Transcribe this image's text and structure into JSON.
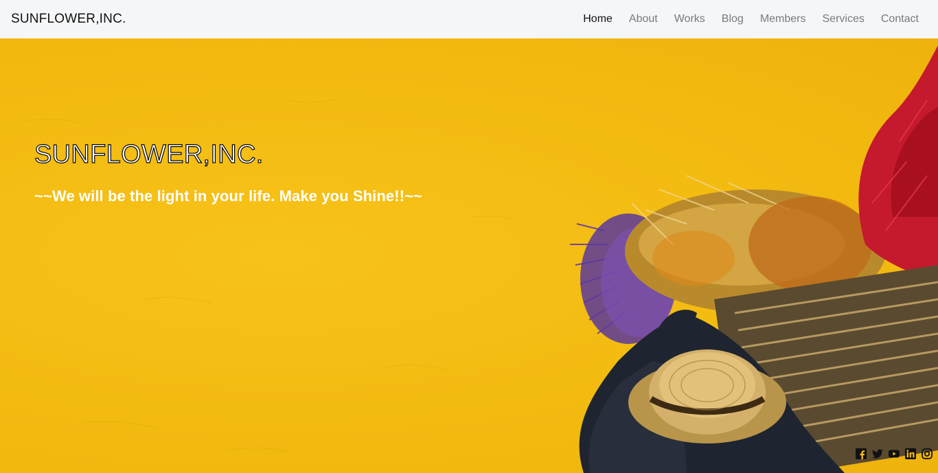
{
  "navbar": {
    "brand": "SUNFLOWER,INC.",
    "links": [
      {
        "label": "Home",
        "active": true
      },
      {
        "label": "About",
        "active": false
      },
      {
        "label": "Works",
        "active": false
      },
      {
        "label": "Blog",
        "active": false
      },
      {
        "label": "Members",
        "active": false
      },
      {
        "label": "Services",
        "active": false
      },
      {
        "label": "Contact",
        "active": false
      }
    ]
  },
  "hero": {
    "title": "SUNFLOWER,INC.",
    "subtitle": "~~We will be the light in your life. Make you Shine!!~~",
    "background_color": "#f3bb10"
  },
  "social": {
    "icons": [
      "facebook-icon",
      "twitter-icon",
      "youtube-icon",
      "linkedin-icon",
      "instagram-icon"
    ]
  },
  "colors": {
    "navbar_bg": "#f5f6f8",
    "nav_active": "#111111",
    "nav_inactive": "#777a7e",
    "hero_text": "#ffffff"
  }
}
